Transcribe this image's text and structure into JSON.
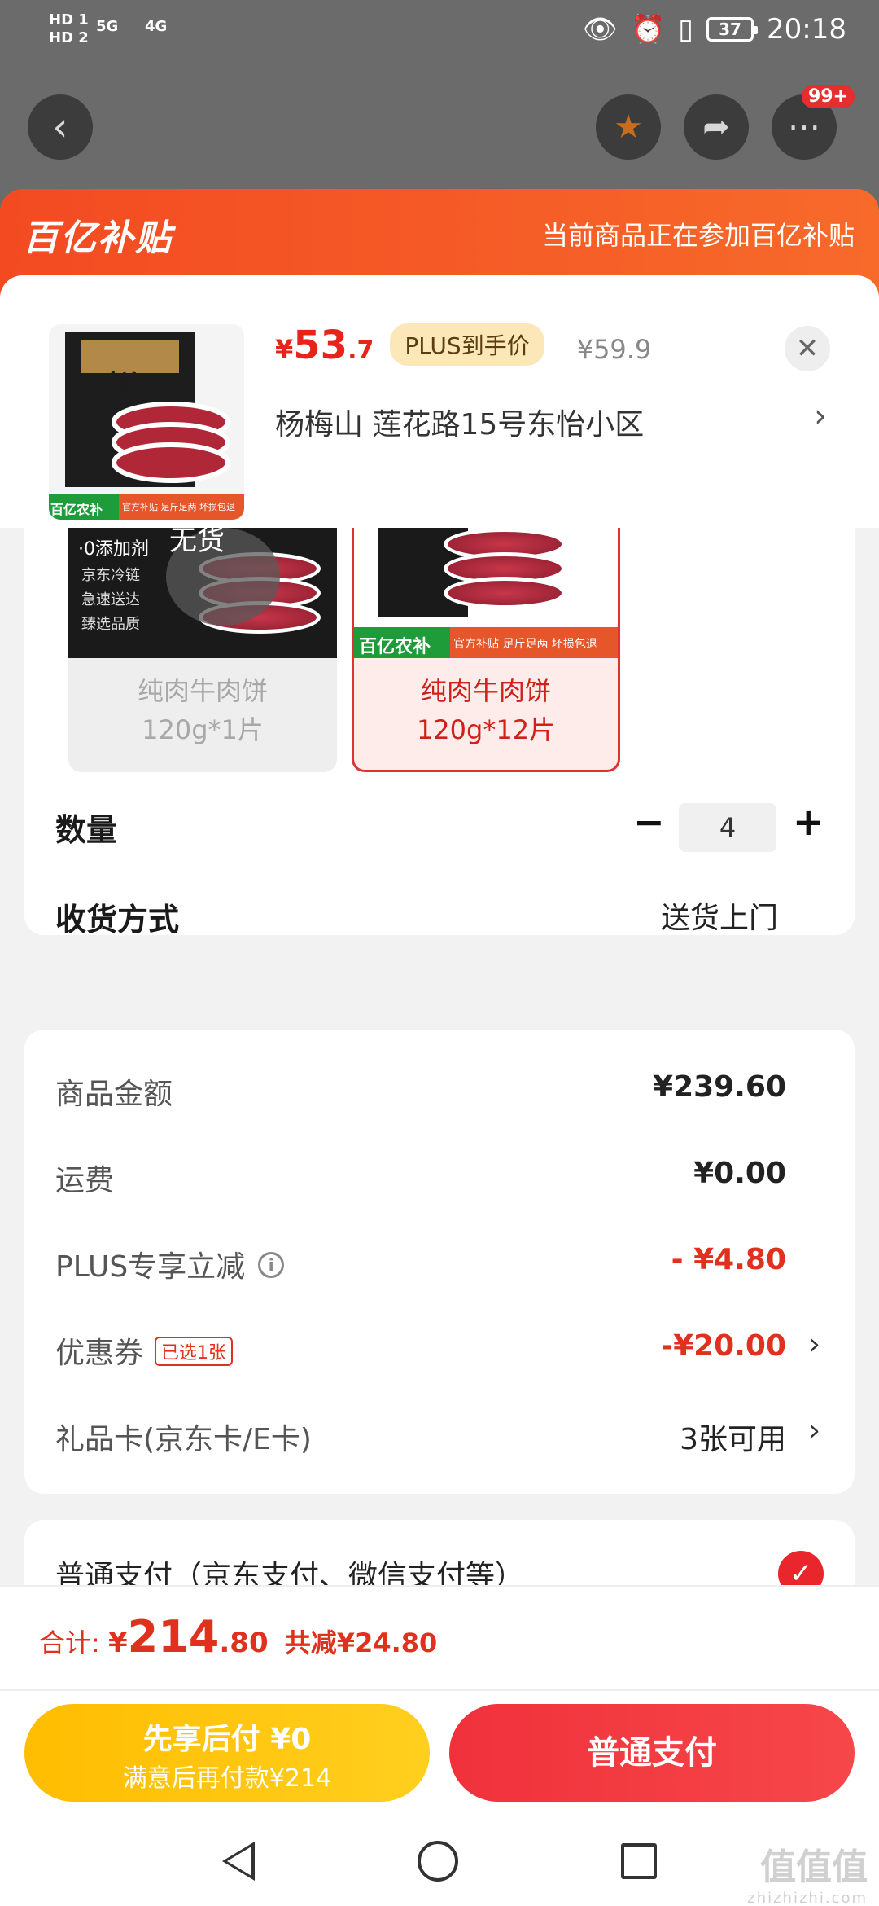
{
  "status_bar": {
    "sim1": "HD 1",
    "sim2": "HD 2",
    "net1": "5G",
    "net2": "4G",
    "battery": "37",
    "time": "20:18"
  },
  "top_nav": {
    "notification_badge": "99+"
  },
  "banner": {
    "logo": "百亿补贴",
    "message": "当前商品正在参加百亿补贴"
  },
  "product": {
    "price_currency": "¥",
    "price_int": "53",
    "price_dec": ".7",
    "plus_tag": "PLUS到手价",
    "original_price": "¥59.9",
    "address": "杨梅山  莲花路15号东怡小区",
    "thumb_badge": "百亿农补",
    "thumb_tag": "官方补贴  足斤足两  坏损包退",
    "thumb_brand": "鲜"
  },
  "variants": [
    {
      "name": "纯肉牛肉饼",
      "spec": "120g*1片",
      "selected": false,
      "img_text_1": "·0添加剂",
      "img_text_2": "京东冷链",
      "img_text_3": "急速送达",
      "img_text_4": "臻选品质",
      "img_text_5": "无货"
    },
    {
      "name": "纯肉牛肉饼",
      "spec": "120g*12片",
      "selected": true,
      "img_badge": "百亿农补",
      "img_tag": "官方补贴  足斤足两  坏损包退"
    }
  ],
  "quantity": {
    "label": "数量",
    "minus": "−",
    "value": "4",
    "plus": "+"
  },
  "delivery": {
    "label": "收货方式",
    "value": "送货上门"
  },
  "summary": {
    "goods_amount_label": "商品金额",
    "goods_amount": "¥239.60",
    "shipping_label": "运费",
    "shipping": "¥0.00",
    "plus_discount_label": "PLUS专享立减",
    "plus_discount": "- ¥4.80",
    "coupon_label": "优惠券",
    "coupon_tag": "已选1张",
    "coupon_value": "-¥20.00",
    "giftcard_label": "礼品卡(京东卡/E卡)",
    "giftcard_value": "3张可用"
  },
  "payment": {
    "method_label": "普通支付（京东支付、微信支付等）"
  },
  "total": {
    "label": "合计:",
    "currency": "¥",
    "int": "214",
    "dec": ".80",
    "reduce_label": "共减",
    "reduce_value": "¥24.80"
  },
  "buttons": {
    "later_line1": "先享后付 ¥0",
    "later_line2": "满意后再付款¥214",
    "pay": "普通支付"
  },
  "watermark": {
    "main": "值值值",
    "sub": "zhizhizhi.com"
  }
}
